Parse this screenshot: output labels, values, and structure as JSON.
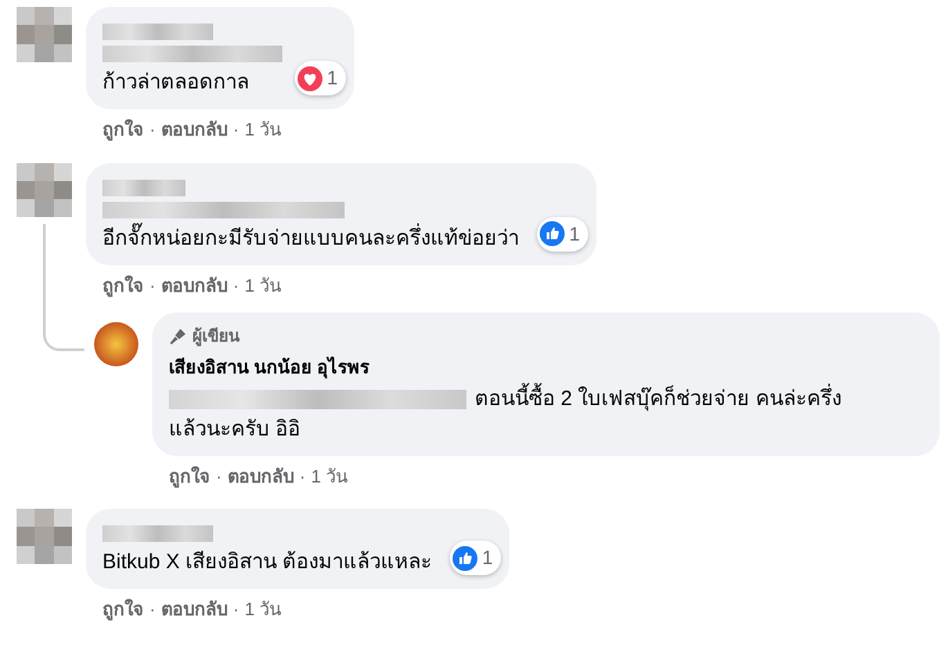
{
  "separator": "·",
  "comments": [
    {
      "kind": "redacted",
      "lines": [
        {
          "kind": "blurred"
        },
        {
          "kind": "blurred"
        },
        {
          "kind": "text",
          "text": "ก้าวล่าตลอดกาล"
        }
      ],
      "reaction": {
        "kind": "heart",
        "count": "1"
      },
      "actions": [
        {
          "kind": "link",
          "text": "ถูกใจ"
        },
        {
          "kind": "link",
          "text": "ตอบกลับ"
        },
        {
          "kind": "time",
          "text": "1 วัน"
        }
      ]
    },
    {
      "kind": "redacted",
      "lines": [
        {
          "kind": "blurred"
        },
        {
          "kind": "blurred"
        },
        {
          "kind": "text",
          "text": "อีกจั๊กหน่อยกะมีรับจ่ายแบบคนละครึ่งแท้ข่อยว่า"
        }
      ],
      "reaction": {
        "kind": "like",
        "count": "1"
      },
      "actions": [
        {
          "kind": "link",
          "text": "ถูกใจ"
        },
        {
          "kind": "link",
          "text": "ตอบกลับ"
        },
        {
          "kind": "time",
          "text": "1 วัน"
        }
      ],
      "children": [
        {
          "kind": "author",
          "author_badge": "ผู้เขียน",
          "name": "เสียงอิสาน นกน้อย อุไรพร",
          "lines": [
            {
              "kind": "mention_text",
              "text": "ตอนนี้ซื้อ 2 ใบเฟสบุ๊คก็ช่วยจ่าย คนล่ะครึ่ง"
            },
            {
              "kind": "text",
              "text": "แล้วนะครับ อิอิ"
            }
          ],
          "actions": [
            {
              "kind": "link",
              "text": "ถูกใจ"
            },
            {
              "kind": "link",
              "text": "ตอบกลับ"
            },
            {
              "kind": "time",
              "text": "1 วัน"
            }
          ]
        }
      ]
    },
    {
      "kind": "redacted",
      "lines": [
        {
          "kind": "blurred"
        },
        {
          "kind": "text",
          "text": "Bitkub X เสียงอิสาน ต้องมาแล้วแหละ"
        }
      ],
      "reaction": {
        "kind": "like",
        "count": "1"
      },
      "actions": [
        {
          "kind": "link",
          "text": "ถูกใจ"
        },
        {
          "kind": "link",
          "text": "ตอบกลับ"
        },
        {
          "kind": "time",
          "text": "1 วัน"
        }
      ]
    }
  ]
}
